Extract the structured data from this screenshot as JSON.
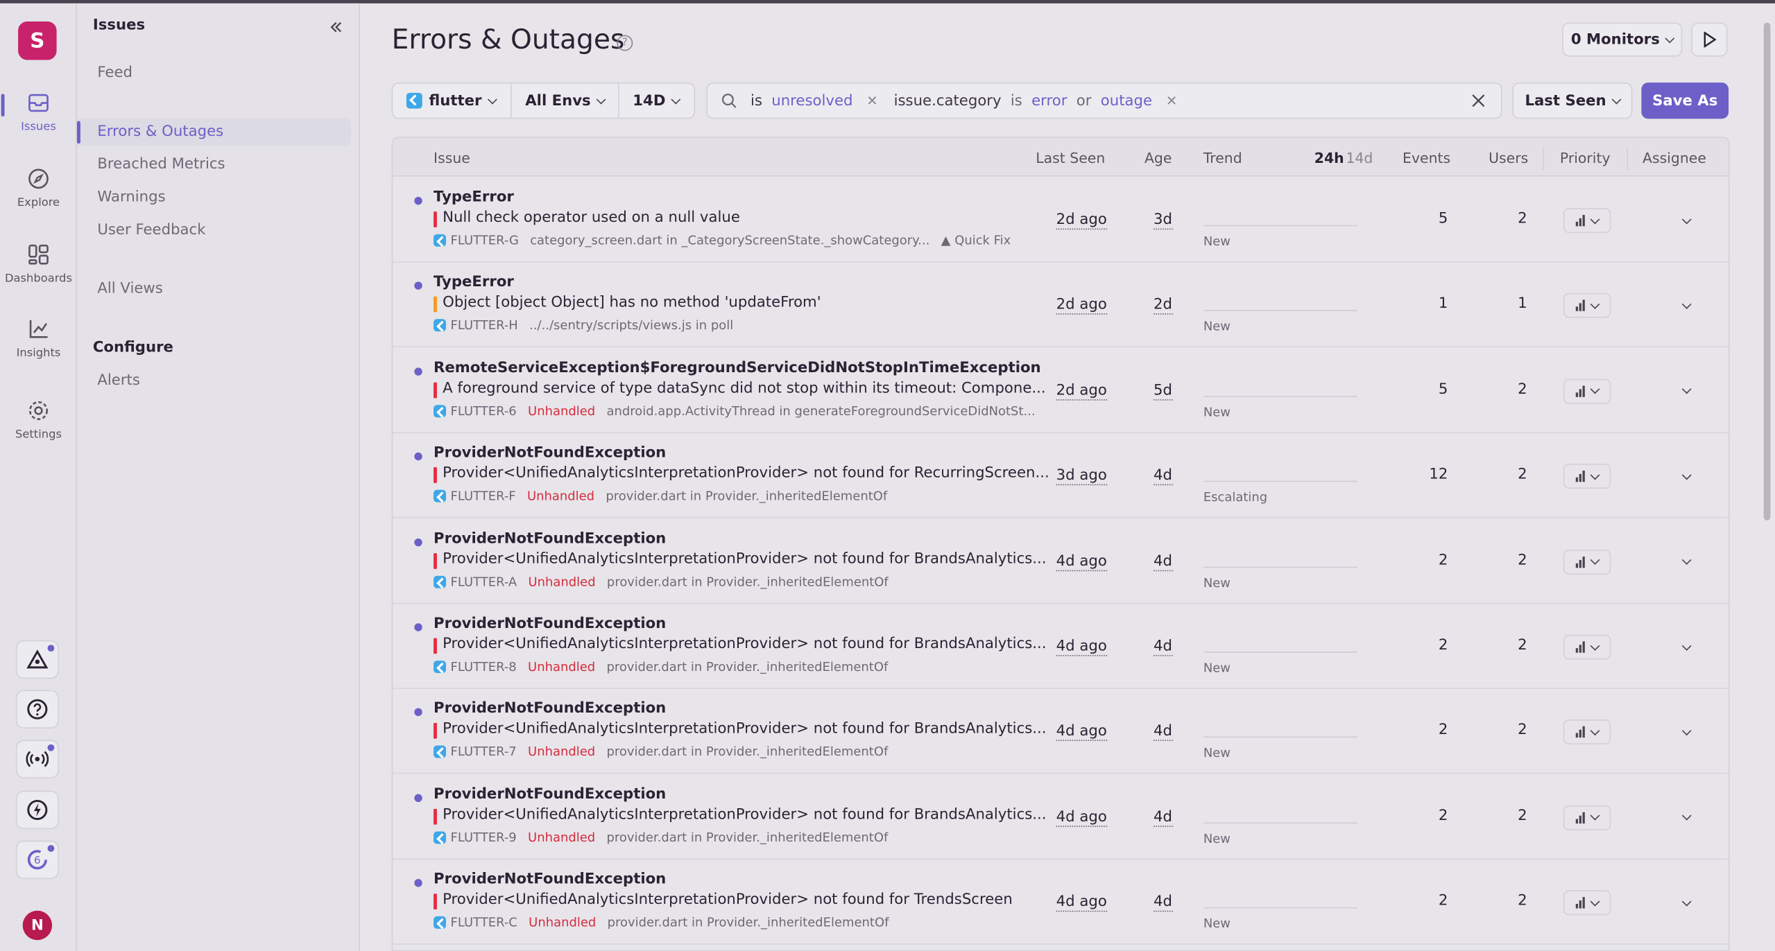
{
  "org_initial": "S",
  "user_initial": "N",
  "rail": [
    {
      "label": "Issues",
      "icon": "issues-icon",
      "active": true
    },
    {
      "label": "Explore",
      "icon": "compass-icon"
    },
    {
      "label": "Dashboards",
      "icon": "dashboard-icon"
    },
    {
      "label": "Insights",
      "icon": "chart-icon"
    },
    {
      "label": "Settings",
      "icon": "gear-icon"
    }
  ],
  "nav": {
    "title": "Issues",
    "items": [
      "Feed",
      "Errors & Outages",
      "Breached Metrics",
      "Warnings",
      "User Feedback",
      "All Views"
    ],
    "configure_title": "Configure",
    "configure_items": [
      "Alerts"
    ]
  },
  "header": {
    "title": "Errors & Outages",
    "help": "?",
    "monitors": "0 Monitors"
  },
  "filters": {
    "project": "flutter",
    "env": "All Envs",
    "range": "14D",
    "search_tokens": [
      {
        "key": "is",
        "op": "",
        "values": "unresolved"
      },
      {
        "key": "issue.category",
        "op": "is",
        "v1": "error",
        "or": "or",
        "v2": "outage"
      }
    ],
    "sort": "Last Seen",
    "save_as": "Save As"
  },
  "table": {
    "headers": {
      "issue": "Issue",
      "last_seen": "Last Seen",
      "age": "Age",
      "trend": "Trend",
      "p24h": "24h",
      "p14d": "14d",
      "events": "Events",
      "users": "Users",
      "priority": "Priority",
      "assignee": "Assignee"
    },
    "rows": [
      {
        "title": "TypeError",
        "message": "Null check operator used on a null value",
        "level": "high",
        "short_id": "FLUTTER-G",
        "unhandled": "",
        "culprit": "category_screen.dart in _CategoryScreenState._showCategory...",
        "extra": "Quick Fix",
        "last_seen": "2d ago",
        "age": "3d",
        "trend": "New",
        "events": "5",
        "users": "2"
      },
      {
        "title": "TypeError",
        "message": "Object [object Object] has no method 'updateFrom'",
        "level": "med",
        "short_id": "FLUTTER-H",
        "unhandled": "",
        "culprit": "../../sentry/scripts/views.js in poll",
        "extra": "",
        "last_seen": "2d ago",
        "age": "2d",
        "trend": "New",
        "events": "1",
        "users": "1"
      },
      {
        "title": "RemoteServiceException$ForegroundServiceDidNotStopInTimeException",
        "message": "A foreground service of type dataSync did not stop within its timeout: Compone...",
        "level": "high",
        "short_id": "FLUTTER-6",
        "unhandled": "Unhandled",
        "culprit": "android.app.ActivityThread in generateForegroundServiceDidNotSt...",
        "extra": "",
        "last_seen": "2d ago",
        "age": "5d",
        "trend": "New",
        "events": "5",
        "users": "2"
      },
      {
        "title": "ProviderNotFoundException",
        "message": "Provider<UnifiedAnalyticsInterpretationProvider> not found for RecurringScreen...",
        "level": "high",
        "short_id": "FLUTTER-F",
        "unhandled": "Unhandled",
        "culprit": "provider.dart in Provider._inheritedElementOf",
        "extra": "",
        "last_seen": "3d ago",
        "age": "4d",
        "trend": "Escalating",
        "events": "12",
        "users": "2"
      },
      {
        "title": "ProviderNotFoundException",
        "message": "Provider<UnifiedAnalyticsInterpretationProvider> not found for BrandsAnalytics...",
        "level": "high",
        "short_id": "FLUTTER-A",
        "unhandled": "Unhandled",
        "culprit": "provider.dart in Provider._inheritedElementOf",
        "extra": "",
        "last_seen": "4d ago",
        "age": "4d",
        "trend": "New",
        "events": "2",
        "users": "2"
      },
      {
        "title": "ProviderNotFoundException",
        "message": "Provider<UnifiedAnalyticsInterpretationProvider> not found for BrandsAnalytics...",
        "level": "high",
        "short_id": "FLUTTER-8",
        "unhandled": "Unhandled",
        "culprit": "provider.dart in Provider._inheritedElementOf",
        "extra": "",
        "last_seen": "4d ago",
        "age": "4d",
        "trend": "New",
        "events": "2",
        "users": "2"
      },
      {
        "title": "ProviderNotFoundException",
        "message": "Provider<UnifiedAnalyticsInterpretationProvider> not found for BrandsAnalytics...",
        "level": "high",
        "short_id": "FLUTTER-7",
        "unhandled": "Unhandled",
        "culprit": "provider.dart in Provider._inheritedElementOf",
        "extra": "",
        "last_seen": "4d ago",
        "age": "4d",
        "trend": "New",
        "events": "2",
        "users": "2"
      },
      {
        "title": "ProviderNotFoundException",
        "message": "Provider<UnifiedAnalyticsInterpretationProvider> not found for BrandsAnalytics...",
        "level": "high",
        "short_id": "FLUTTER-9",
        "unhandled": "Unhandled",
        "culprit": "provider.dart in Provider._inheritedElementOf",
        "extra": "",
        "last_seen": "4d ago",
        "age": "4d",
        "trend": "New",
        "events": "2",
        "users": "2"
      },
      {
        "title": "ProviderNotFoundException",
        "message": "Provider<UnifiedAnalyticsInterpretationProvider> not found for TrendsScreen",
        "level": "high",
        "short_id": "FLUTTER-C",
        "unhandled": "Unhandled",
        "culprit": "provider.dart in Provider._inheritedElementOf",
        "extra": "",
        "last_seen": "4d ago",
        "age": "4d",
        "trend": "New",
        "events": "2",
        "users": "2"
      }
    ]
  }
}
